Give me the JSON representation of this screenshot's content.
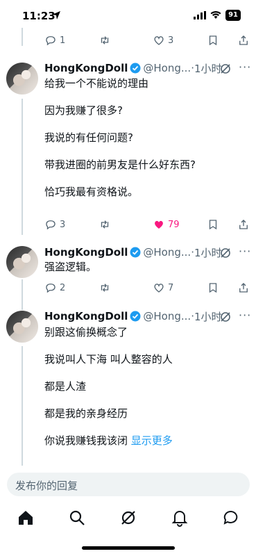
{
  "status": {
    "time": "11:23",
    "battery": "91"
  },
  "tweets": [
    {
      "actions": {
        "reply": "1",
        "like": "3"
      }
    },
    {
      "name": "HongKongDoll",
      "handle": "@Hong...",
      "time": "1小时",
      "lines": [
        "给我一个不能说的理由",
        "因为我赚了很多?",
        "我说的有任何问题?",
        "带我进圈的前男友是什么好东西?",
        "恰巧我最有资格说。"
      ],
      "actions": {
        "reply": "3",
        "like": "79"
      }
    },
    {
      "name": "HongKongDoll",
      "handle": "@Hong...",
      "time": "1小时",
      "lines": [
        "强盗逻辑。"
      ],
      "actions": {
        "reply": "2",
        "like": "7"
      }
    },
    {
      "name": "HongKongDoll",
      "handle": "@Hong...",
      "time": "1小时",
      "lines": [
        "别跟这偷换概念了",
        "我说叫人下海 叫人整容的人",
        "都是人渣",
        "都是我的亲身经历",
        "你说我赚钱我该闭"
      ],
      "show_more": "显示更多"
    }
  ],
  "reply_placeholder": "发布你的回复",
  "nav": [
    "home-icon",
    "search-icon",
    "grok-icon",
    "notifications-icon",
    "messages-icon"
  ],
  "colors": {
    "like": "#f91880",
    "link": "#1d9bf0",
    "verified": "#1d9bf0",
    "muted": "#536471"
  }
}
